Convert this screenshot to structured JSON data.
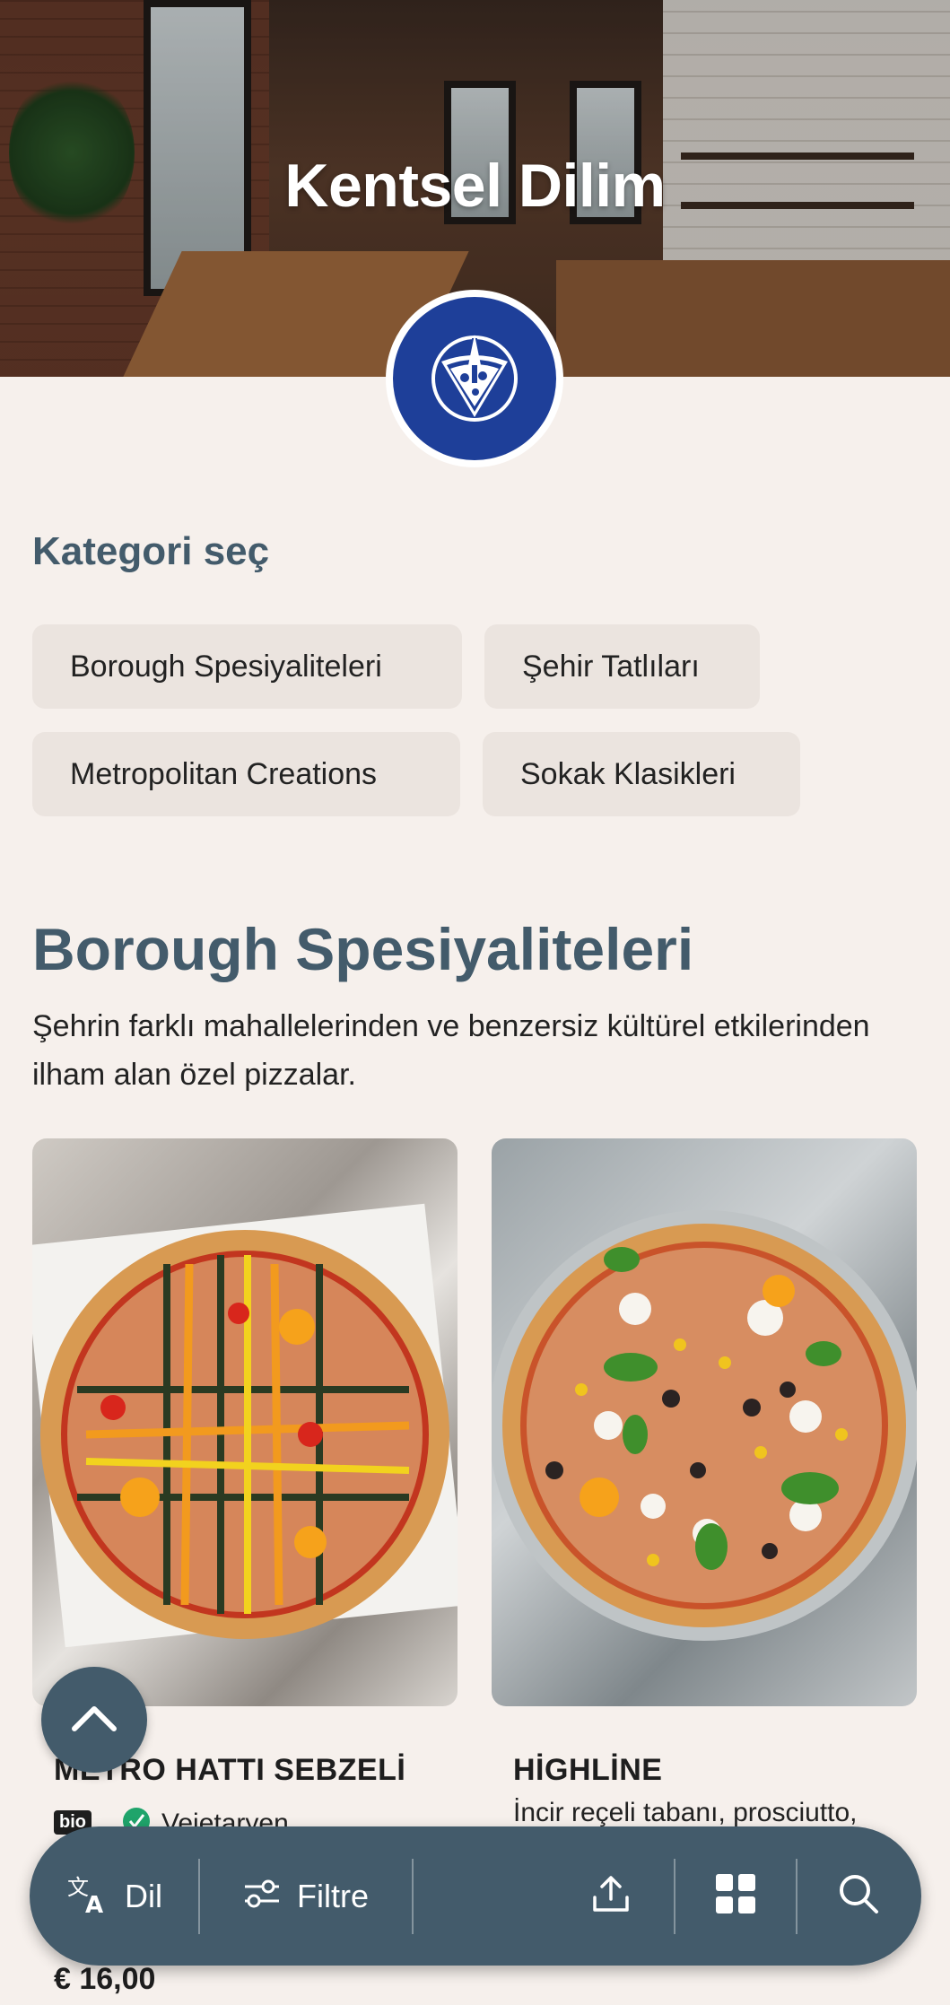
{
  "header": {
    "title": "Kentsel Dilim",
    "logo_icon": "pizza-slice-landmark-logo"
  },
  "categories": {
    "heading": "Kategori seç",
    "items": [
      {
        "label": "Borough Spesiyaliteleri"
      },
      {
        "label": "Şehir Tatlıları"
      },
      {
        "label": "Metropolitan Creations"
      },
      {
        "label": "Sokak Klasikleri"
      }
    ]
  },
  "section": {
    "title": "Borough Spesiyaliteleri",
    "description": "Şehrin farklı mahallelerinden ve benzersiz kültürel etkilerinden ilham alan özel pizzalar."
  },
  "products": [
    {
      "name": "METRO HATTI SEBZELİ",
      "badge": "bio",
      "tag": "Vejetaryen",
      "price": "€ 16,00"
    },
    {
      "name": "HİGHLİNE",
      "description": "İncir reçeli tabanı, prosciutto,"
    }
  ],
  "bottom_bar": {
    "language_label": "Dil",
    "filter_label": "Filtre",
    "icons": [
      "translate-icon",
      "filter-icon",
      "share-icon",
      "grid-icon",
      "search-icon"
    ]
  },
  "colors": {
    "accent": "#435b6b",
    "logo_blue": "#1e3f99",
    "background": "#f6f0ec",
    "chip": "#ebe4df"
  }
}
